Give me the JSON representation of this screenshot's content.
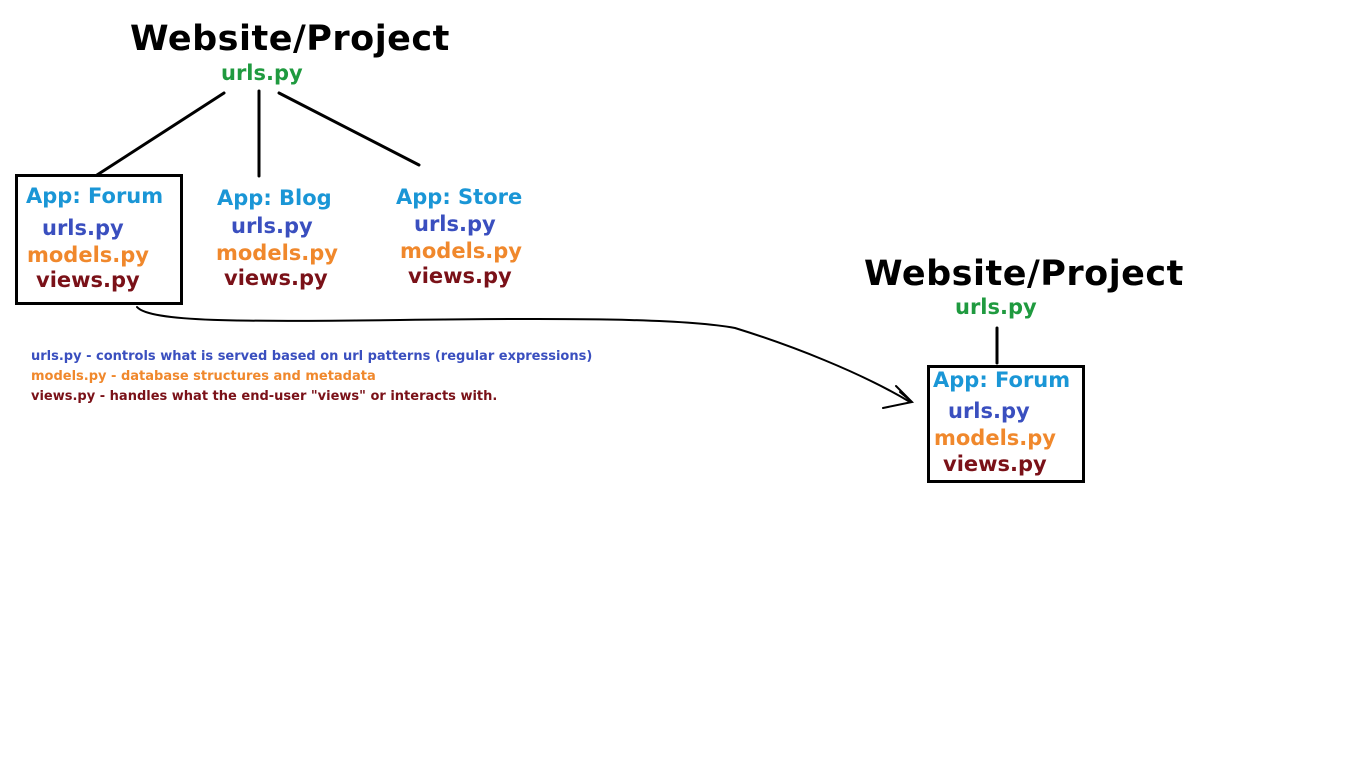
{
  "colors": {
    "title": "#000000",
    "project_urls": "#1f9a3f",
    "app_name": "#1a96d6",
    "urls": "#3a4fbf",
    "models": "#f0882c",
    "views": "#7a1118",
    "lines": "#000000"
  },
  "left_project": {
    "title": "Website/Project",
    "urls": "urls.py",
    "apps": [
      {
        "name": "App: Forum",
        "urls": "urls.py",
        "models": "models.py",
        "views": "views.py"
      },
      {
        "name": "App: Blog",
        "urls": "urls.py",
        "models": "models.py",
        "views": "views.py"
      },
      {
        "name": "App: Store",
        "urls": "urls.py",
        "models": "models.py",
        "views": "views.py"
      }
    ]
  },
  "legend": {
    "urls": "urls.py - controls what is served based on url patterns (regular expressions)",
    "models": "models.py - database structures and metadata",
    "views": "views.py - handles what the end-user \"views\" or interacts with."
  },
  "right_project": {
    "title": "Website/Project",
    "urls": "urls.py",
    "app": {
      "name": "App: Forum",
      "urls": "urls.py",
      "models": "models.py",
      "views": "views.py"
    }
  }
}
